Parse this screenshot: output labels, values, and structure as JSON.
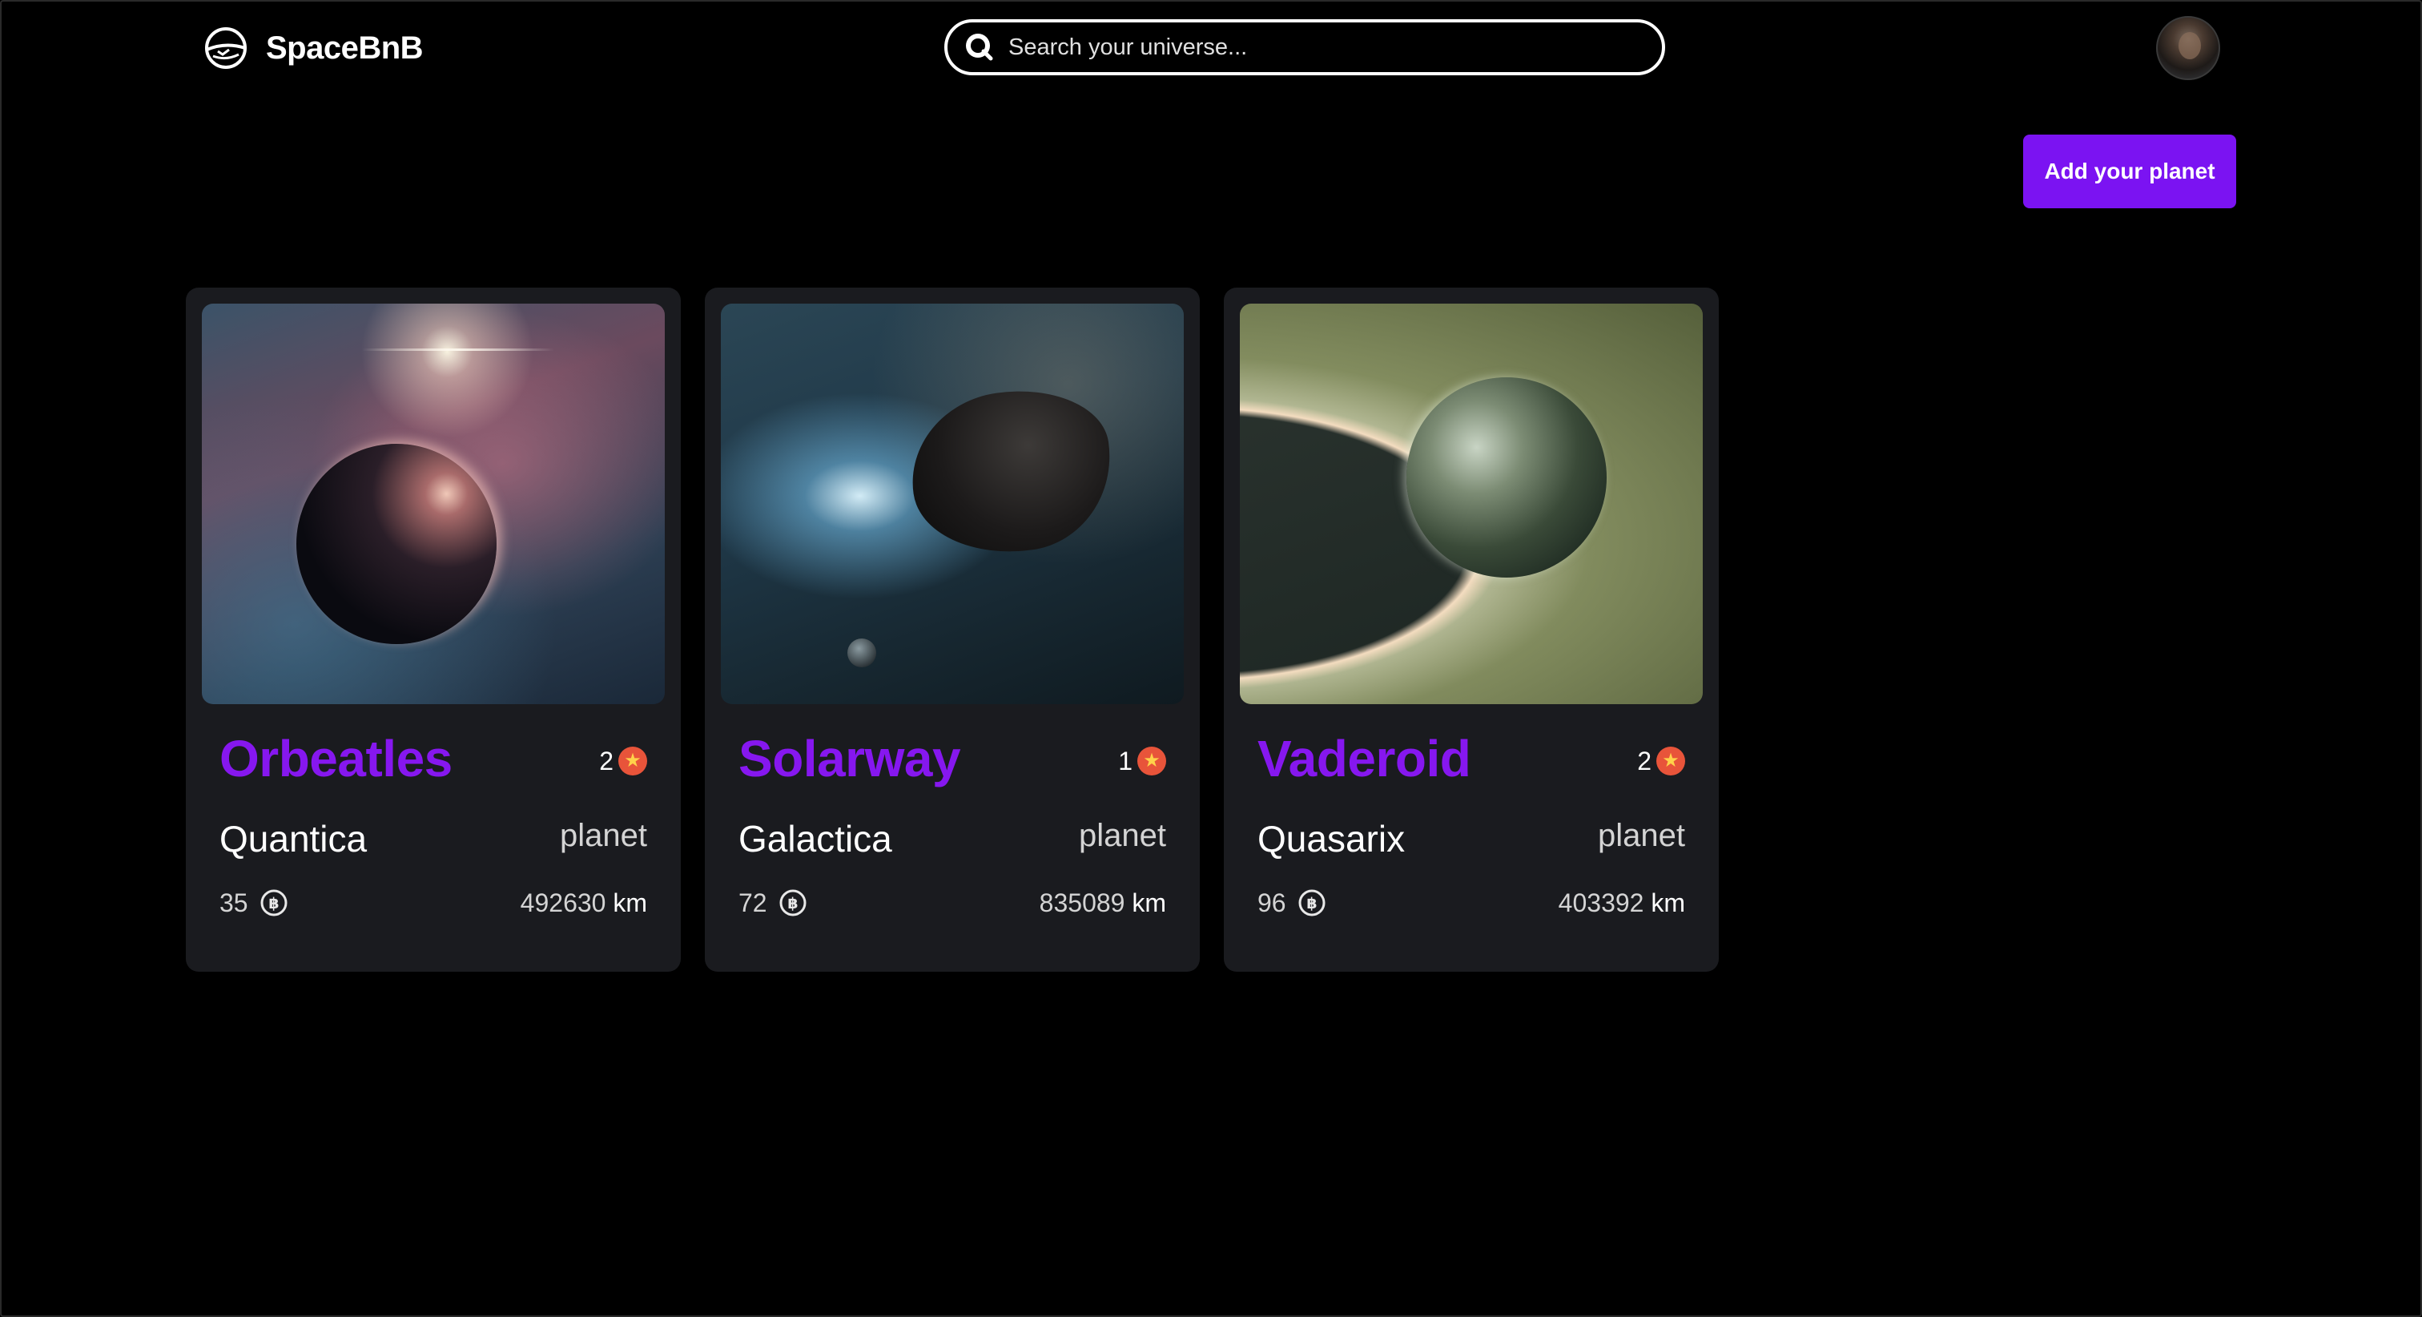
{
  "header": {
    "brand": "SpaceBnB",
    "search_placeholder": "Search your universe..."
  },
  "actions": {
    "add_label": "Add your planet"
  },
  "colors": {
    "accent": "#7b13f2",
    "name": "#8617ef",
    "card_bg": "#1a1b1f",
    "star_badge": "#e8543a"
  },
  "listings": [
    {
      "name": "Orbeatles",
      "rating": "2",
      "galaxy": "Quantica",
      "type": "planet",
      "price": "35",
      "distance": "492630",
      "unit": "km"
    },
    {
      "name": "Solarway",
      "rating": "1",
      "galaxy": "Galactica",
      "type": "planet",
      "price": "72",
      "distance": "835089",
      "unit": "km"
    },
    {
      "name": "Vaderoid",
      "rating": "2",
      "galaxy": "Quasarix",
      "type": "planet",
      "price": "96",
      "distance": "403392",
      "unit": "km"
    }
  ]
}
